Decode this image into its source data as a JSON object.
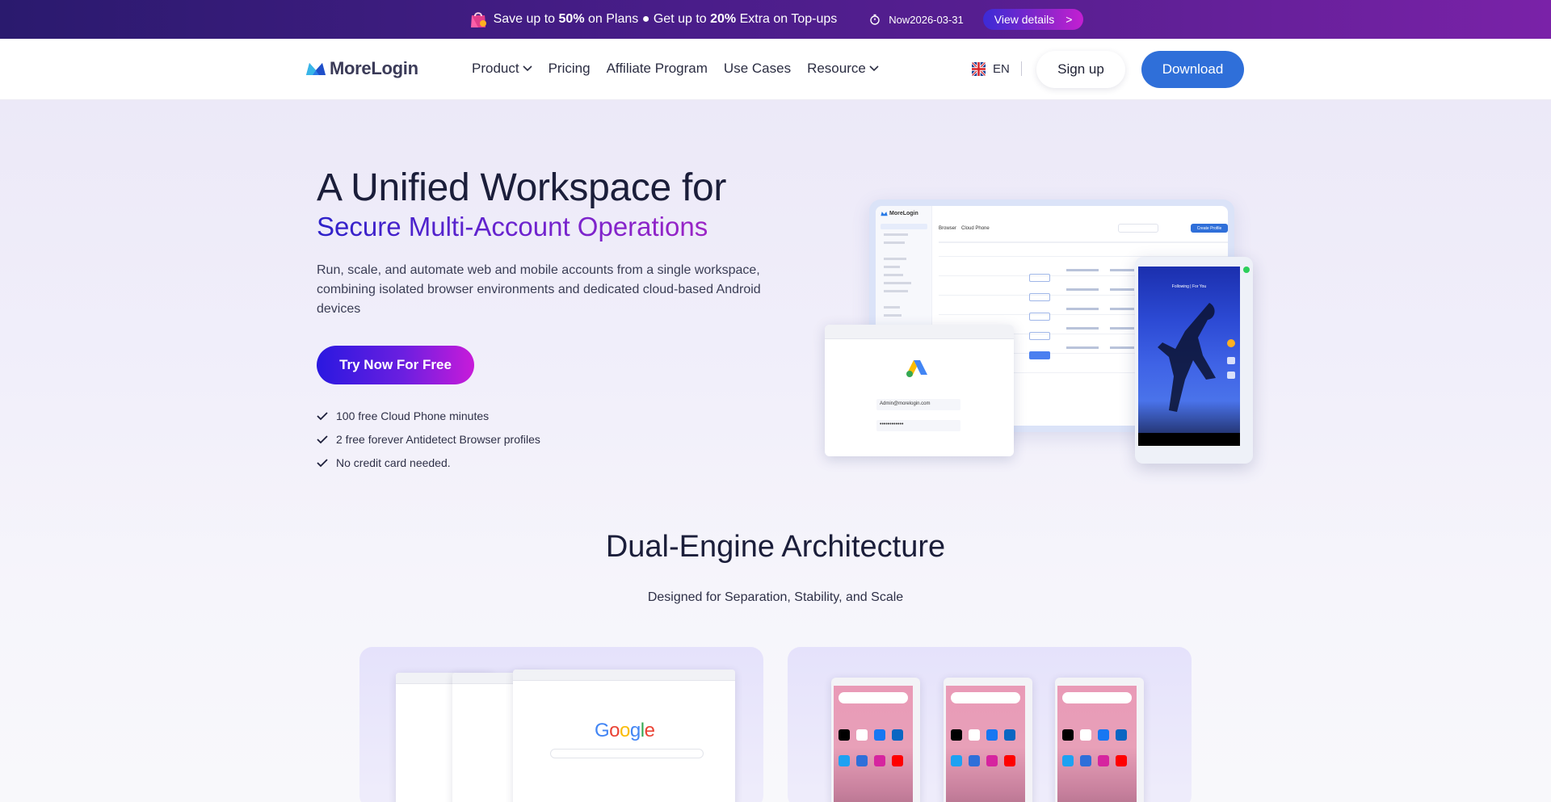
{
  "promo": {
    "text_1": "Save up to ",
    "pct_1": "50%",
    "text_2": " on Plans",
    "bullet": " ● ",
    "text_3": "Get up to ",
    "pct_2": "20%",
    "text_4": " Extra on Top-ups",
    "timer": "Now2026-03-31",
    "details_label": "View details",
    "details_arrow": ">"
  },
  "nav": {
    "logo": "MoreLogin",
    "items": [
      {
        "label": "Product",
        "dropdown": true
      },
      {
        "label": "Pricing",
        "dropdown": false
      },
      {
        "label": "Affiliate Program",
        "dropdown": false
      },
      {
        "label": "Use Cases",
        "dropdown": false
      },
      {
        "label": "Resource",
        "dropdown": true
      }
    ],
    "lang": "EN",
    "signup": "Sign up",
    "download": "Download"
  },
  "hero": {
    "title": "A Unified Workspace for",
    "title_accent": "Secure Multi-Account Operations",
    "lead": "Run, scale, and automate web and mobile accounts from a single workspace, combining isolated browser environments and dedicated cloud-based Android devices",
    "cta": "Try Now For Free",
    "checks": [
      "100 free Cloud Phone minutes",
      "2 free forever Antidetect Browser profiles",
      "No credit card needed."
    ],
    "mock": {
      "app_name": "MoreLogin",
      "tab_browser": "Browser",
      "tab_cloud": "Cloud Phone",
      "create_btn": "Create Profile",
      "login_email": "Admin@morelogin.com",
      "login_pass": "••••••••••••",
      "phone_header": "Following | For You"
    }
  },
  "section": {
    "title": "Dual-Engine Architecture",
    "subtitle": "Designed for Separation, Stability, and Scale",
    "google_word": "Google"
  },
  "colors": {
    "brand_blue": "#2f6fd9",
    "cta_start": "#2a18e0",
    "cta_end": "#c81bd9",
    "promo_bg": "#4a1d8a"
  }
}
